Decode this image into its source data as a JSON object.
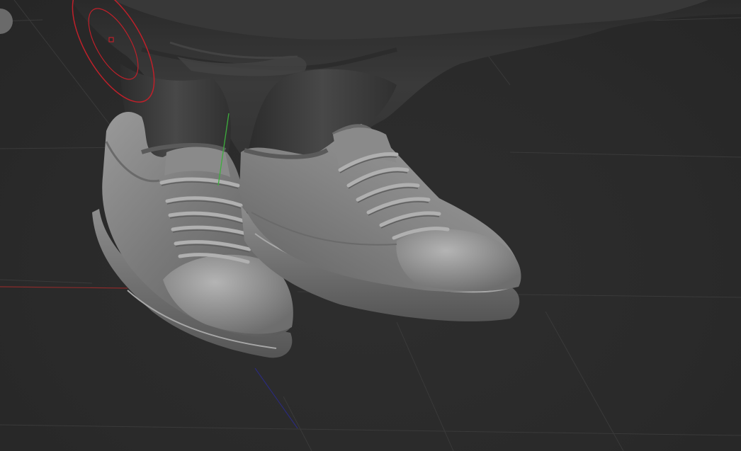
{
  "app": {
    "mode": "sculpt",
    "shading": "solid-matcap"
  },
  "viewport": {
    "background_color": "#2b2b2b",
    "grid_color": "#3a3a3a",
    "axis_x_color": "#8b2b2b",
    "axis_y_color": "#3dae3d",
    "axis_z_color": "#2b2b7a",
    "mesh_color": "#8a8a8a",
    "cloth_color": "#3c3c3c"
  },
  "gizmo": {
    "type": "pose-bone-rotation-ring",
    "ring_color": "#c0202a"
  },
  "objects": [
    {
      "name": "character-body",
      "kind": "mesh"
    },
    {
      "name": "sneaker-left",
      "kind": "mesh"
    },
    {
      "name": "sneaker-right",
      "kind": "mesh"
    }
  ]
}
